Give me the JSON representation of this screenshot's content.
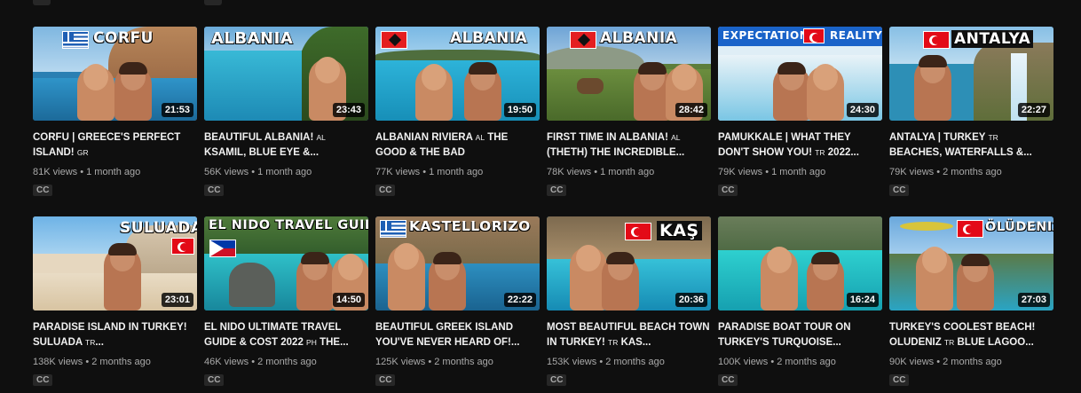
{
  "cc_label": "CC",
  "rows": [
    [
      {
        "overlay": "CORFU",
        "flag": "gr",
        "title": "CORFU | GREECE'S PERFECT ISLAND!",
        "code": "GR",
        "views": "81K views",
        "age": "1 month ago",
        "duration": "21:53"
      },
      {
        "overlay": "ALBANIA",
        "flag": "",
        "title": "BEAUTIFUL ALBANIA!",
        "code": "AL",
        "title2": "KSAMIL, BLUE EYE &...",
        "views": "56K views",
        "age": "1 month ago",
        "duration": "23:43"
      },
      {
        "overlay": "ALBANIA",
        "flag": "al",
        "title": "ALBANIAN RIVIERA",
        "code": "AL",
        "title2": "THE GOOD & THE BAD",
        "views": "77K views",
        "age": "1 month ago",
        "duration": "19:50"
      },
      {
        "overlay": "ALBANIA",
        "flag": "al",
        "title": "FIRST TIME IN ALBANIA!",
        "code": "AL",
        "title2": "(THETH) THE INCREDIBLE...",
        "views": "78K views",
        "age": "1 month ago",
        "duration": "28:42"
      },
      {
        "overlay": "EXPECTATION",
        "overlay2": "REALITY",
        "flag": "tr",
        "title": "PAMUKKALE | WHAT THEY DON'T SHOW YOU!",
        "code": "TR",
        "title2": "2022...",
        "views": "79K views",
        "age": "1 month ago",
        "duration": "24:30"
      },
      {
        "overlay": "ANTALYA",
        "flag": "tr",
        "title": "ANTALYA | TURKEY",
        "code": "TR",
        "title2": "BEACHES, WATERFALLS &...",
        "views": "79K views",
        "age": "2 months ago",
        "duration": "22:27"
      }
    ],
    [
      {
        "overlay": "SULUADA",
        "flag": "tr",
        "title": "PARADISE ISLAND IN TURKEY! SULUADA",
        "code": "TR",
        "title2": "...",
        "views": "138K views",
        "age": "2 months ago",
        "duration": "23:01"
      },
      {
        "overlay": "EL NIDO TRAVEL GUIDE",
        "flag": "ph",
        "title": "EL NIDO ULTIMATE TRAVEL GUIDE & COST 2022",
        "code": "PH",
        "title2": "THE...",
        "views": "46K views",
        "age": "2 months ago",
        "duration": "14:50"
      },
      {
        "overlay": "KASTELLORIZO",
        "flag": "gr",
        "title": "BEAUTIFUL GREEK ISLAND YOU'VE NEVER HEARD OF!...",
        "code": "",
        "title2": "",
        "views": "125K views",
        "age": "2 months ago",
        "duration": "22:22"
      },
      {
        "overlay": "KAŞ",
        "flag": "tr",
        "title": "MOST BEAUTIFUL BEACH TOWN IN TURKEY!",
        "code": "TR",
        "title2": "KAS...",
        "views": "153K views",
        "age": "2 months ago",
        "duration": "20:36"
      },
      {
        "overlay": "",
        "flag": "",
        "title": "PARADISE BOAT TOUR ON TURKEY'S TURQUOISE...",
        "code": "",
        "title2": "",
        "views": "100K views",
        "age": "2 months ago",
        "duration": "16:24"
      },
      {
        "overlay": "ÖLÜDENIZ",
        "flag": "tr",
        "title": "TURKEY'S COOLEST BEACH! OLUDENIZ",
        "code": "TR",
        "title2": "BLUE LAGOO...",
        "views": "90K views",
        "age": "2 months ago",
        "duration": "27:03"
      }
    ]
  ]
}
